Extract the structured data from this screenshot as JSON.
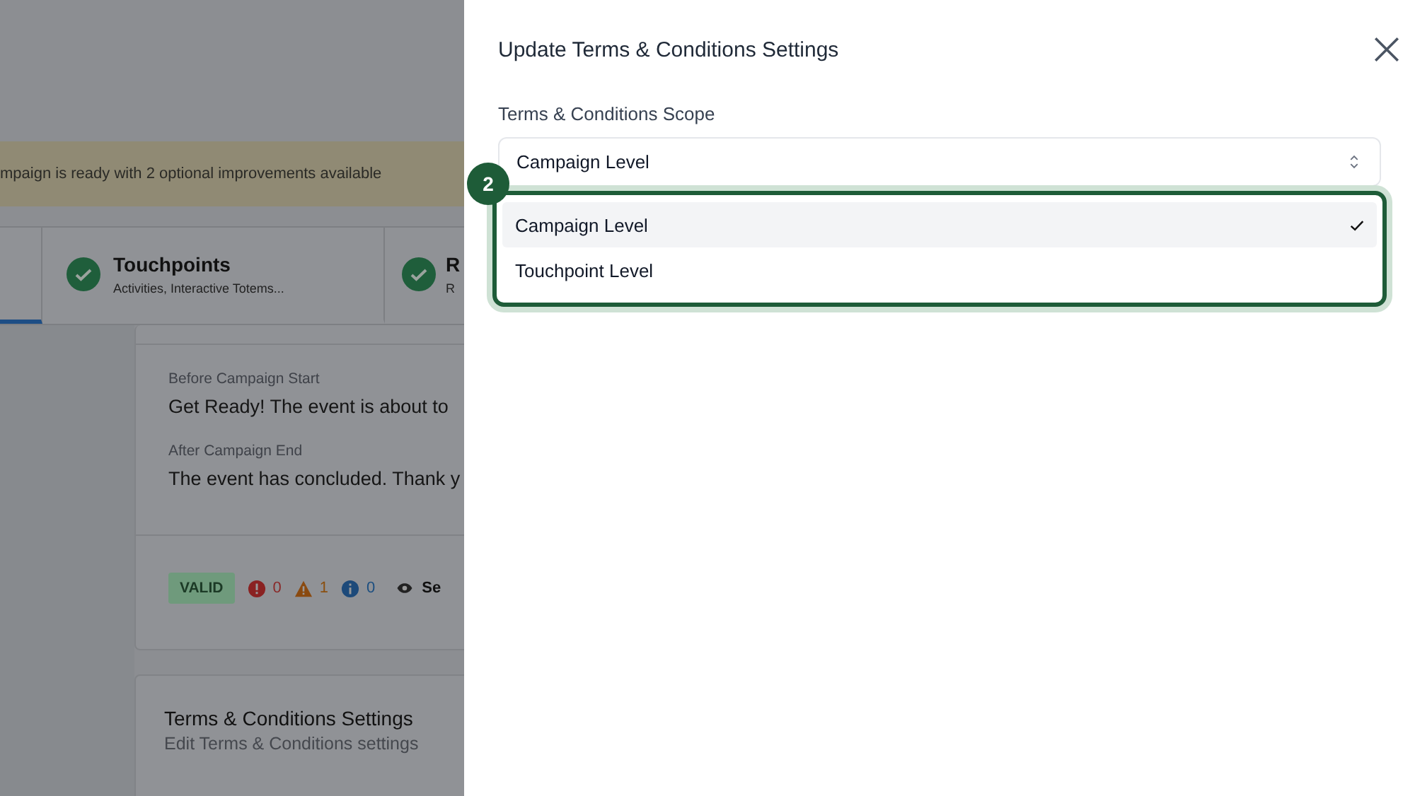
{
  "background": {
    "banner": {
      "text": "mpaign is ready with 2 optional improvements available"
    },
    "steps": [
      {
        "selected": true,
        "done": false
      },
      {
        "title": "Touchpoints",
        "subtitle": "Activities, Interactive Totems...",
        "selected": false,
        "done": true
      },
      {
        "title": "R",
        "subtitle": "R",
        "selected": false,
        "done": true
      }
    ],
    "messages_card": {
      "fields": [
        {
          "label": "Before Campaign Start",
          "value": "Get Ready! The event is about to"
        },
        {
          "label": "After Campaign End",
          "value": "The event has concluded. Thank y"
        }
      ],
      "badge": "VALID",
      "counts": [
        {
          "kind": "error",
          "value": "0"
        },
        {
          "kind": "warning",
          "value": "1"
        },
        {
          "kind": "info",
          "value": "0"
        }
      ],
      "link": "Se"
    },
    "section_card": {
      "title": "Terms & Conditions Settings",
      "subtitle": "Edit Terms & Conditions settings"
    }
  },
  "drawer": {
    "title": "Update Terms & Conditions Settings",
    "field": {
      "label": "Terms & Conditions Scope",
      "value": "Campaign Level"
    },
    "step_badge": "2",
    "options": [
      {
        "label": "Campaign Level",
        "selected": true
      },
      {
        "label": "Touchpoint Level",
        "selected": false
      }
    ]
  }
}
